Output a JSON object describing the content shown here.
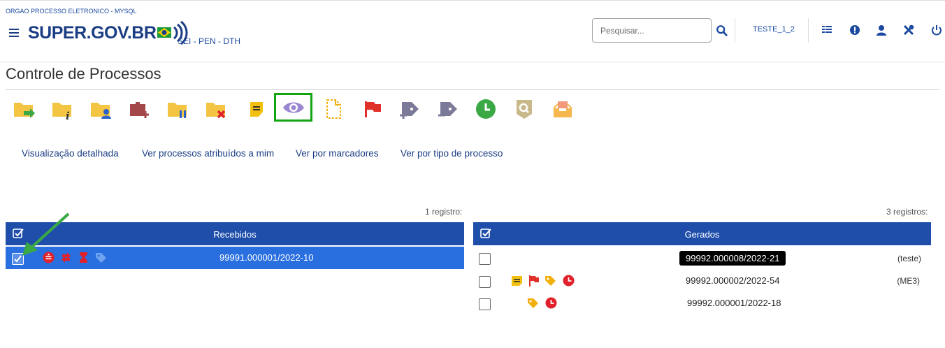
{
  "header": {
    "org": "ORGAO PROCESSO ELETRONICO - MYSQL",
    "logo": "SUPER.GOV.BR",
    "system": "SEI - PEN - DTH",
    "search_placeholder": "Pesquisar...",
    "user": "TESTE_1_2",
    "icons": [
      "search-icon",
      "menu-grid-icon",
      "alert-icon",
      "user-icon",
      "tools-icon",
      "power-icon"
    ]
  },
  "page": {
    "title": "Controle de Processos"
  },
  "toolbar": {
    "icons": [
      "iniciar-processo-icon",
      "informacoes-icon",
      "atribuir-icon",
      "incluir-bloco-icon",
      "sobrestar-icon",
      "concluir-icon",
      "anotacoes-icon",
      "visualizar-icon",
      "documento-icon",
      "acompanhamento-icon",
      "adicionar-marcador-icon",
      "remover-marcador-icon",
      "retorno-programado-icon",
      "pesquisar-icon",
      "receber-icon"
    ],
    "highlighted": "visualizar-icon",
    "highlight_color": "#11a611"
  },
  "views": {
    "detalhada": "Visualização detalhada",
    "atribuidos": "Ver processos atribuídos a mim",
    "marcadores": "Ver por marcadores",
    "tipo": "Ver por tipo de processo"
  },
  "recebidos": {
    "count": "1 registro:",
    "header": "Recebidos",
    "rows": [
      {
        "processo": "99991.000001/2022-10",
        "checked": true,
        "icons": [
          "anotacao-icon",
          "transfer-icon",
          "hourglass-icon",
          "tag-icon"
        ]
      }
    ]
  },
  "gerados": {
    "count": "3 registros:",
    "header": "Gerados",
    "rows": [
      {
        "processo": "99992.000008/2022-21",
        "note": "(teste)",
        "icons": []
      },
      {
        "processo": "99992.000002/2022-54",
        "note": "(ME3)",
        "icons": [
          "anotacao-icon",
          "flag-icon",
          "tag-icon",
          "clock-icon"
        ]
      },
      {
        "processo": "99992.000001/2022-18",
        "note": "",
        "icons": [
          "tag-icon",
          "clock-icon"
        ]
      }
    ]
  },
  "colors": {
    "primary": "#1e4eaa",
    "selected_row": "#2a6fe0",
    "link": "#1b3d84",
    "red": "#e0202a",
    "yellow": "#f2c10f"
  }
}
